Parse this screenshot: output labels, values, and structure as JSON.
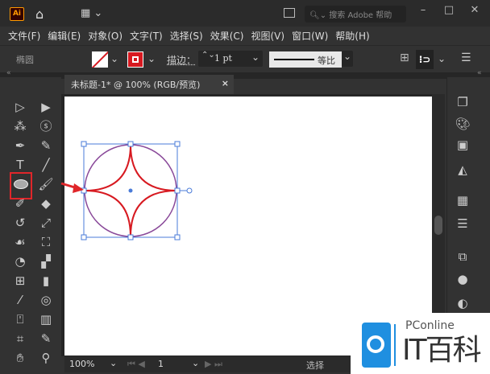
{
  "app": {
    "logo": "Ai",
    "search_placeholder": "搜索 Adobe 帮助"
  },
  "menu": [
    "文件(F)",
    "编辑(E)",
    "对象(O)",
    "文字(T)",
    "选择(S)",
    "效果(C)",
    "视图(V)",
    "窗口(W)",
    "帮助(H)"
  ],
  "control": {
    "tool_name": "椭圆",
    "stroke_label": "描边：",
    "stroke_weight": "1 pt",
    "profile": "等比",
    "stroke_color": "#d71920"
  },
  "document": {
    "tab_title": "未标题-1* @ 100% (RGB/预览)",
    "close": "×"
  },
  "status": {
    "zoom": "100%",
    "artboard": "1",
    "mode": "选择"
  },
  "watermark": {
    "brand": "PConline",
    "name": "IT百科"
  },
  "tools": {
    "selected": "ellipse-tool"
  },
  "colors": {
    "shape_stroke": "#d71920",
    "circle_stroke": "#8a4a9a",
    "selection": "#4a7bd8",
    "highlight": "#e0262a",
    "logo_blue": "#1f8fe0"
  }
}
